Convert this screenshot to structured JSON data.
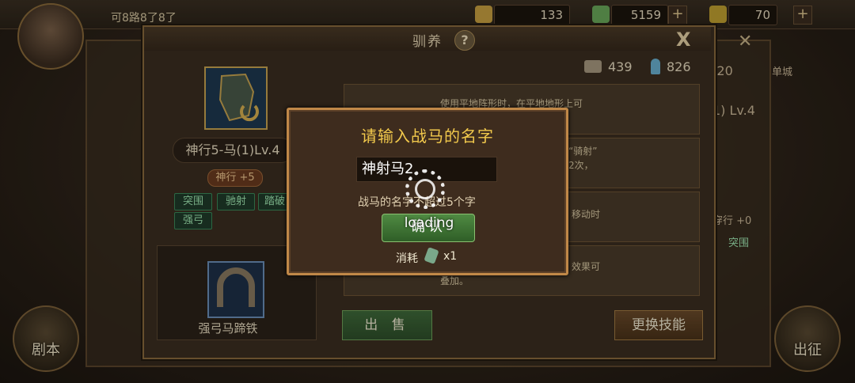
{
  "top": {
    "status_text": "可8路8了8了",
    "resources": [
      {
        "value": "133",
        "icon": "gold-ingot-icon"
      },
      {
        "value": "5159",
        "icon": "jade-icon"
      },
      {
        "value": "70",
        "icon": "feather-icon"
      }
    ],
    "plus": "+"
  },
  "side": {
    "left_button": "剧本",
    "right_button": "出征"
  },
  "rear": {
    "count_text": "/20",
    "level_text": "1) Lv.4",
    "tag1": "突围",
    "tag2": "穿行 +0",
    "corner_text": "单城"
  },
  "panel": {
    "title": "驯养",
    "help": "?",
    "close": "X",
    "horse_name": "神行5-马(1)Lv.4",
    "bonus": "神行 +5",
    "skills": [
      "突围",
      "驰射",
      "踏破",
      "强弓"
    ],
    "equipment_name": "强弓马蹄铁",
    "stats": [
      {
        "icon": "horse-food-icon",
        "value": "439"
      },
      {
        "icon": "potion-icon",
        "value": "826"
      }
    ],
    "rows": [
      {
        "text": "使用平地阵形时，在平地地形上可"
      },
      {
        "text": "“骑射”",
        "text2": "2次，"
      },
      {
        "text": "移动时"
      },
      {
        "text": "效果可",
        "text2": "叠加。"
      }
    ],
    "sell_button": "出 售",
    "change_button": "更换技能"
  },
  "dialog": {
    "title": "请输入战马的名字",
    "input_value": "神射马2",
    "hint": "战马的名字不超过5个字",
    "confirm": "确认",
    "cost_label": "消耗",
    "cost_icon": "rename-token-icon",
    "cost_amount": "x1",
    "loading": "loading"
  }
}
